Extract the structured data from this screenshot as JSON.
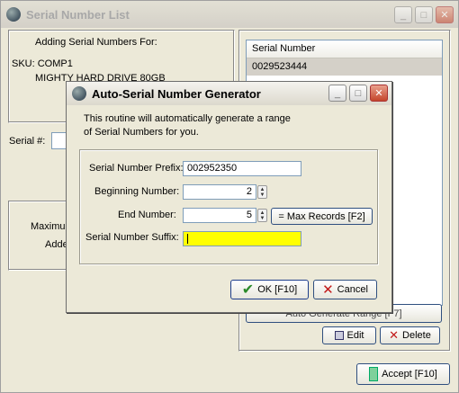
{
  "main_window": {
    "title": "Serial Number List",
    "adding_label": "Adding Serial Numbers For:",
    "sku_line": "SKU: COMP1",
    "product_line": "MIGHTY HARD DRIVE 80GB",
    "serial_label": "Serial #:",
    "max_label_partial": "Maximum",
    "added_label_partial": "Adde",
    "list_header": "Serial Number",
    "list_items": [
      "0029523444"
    ],
    "auto_generate_label_partial": "Auto Generate Range [F7]",
    "edit_label": "Edit",
    "delete_label": "Delete",
    "accept_label": "Accept [F10]"
  },
  "dialog": {
    "title": "Auto-Serial Number Generator",
    "intro_line1": "This routine will automatically generate a range",
    "intro_line2": "of Serial Numbers for you.",
    "prefix_label": "Serial Number Prefix:",
    "prefix_value": "002952350",
    "begin_label": "Beginning Number:",
    "begin_value": "2",
    "end_label": "End Number:",
    "end_value": "5",
    "max_records_label": "= Max Records [F2]",
    "suffix_label": "Serial Number Suffix:",
    "suffix_value": "",
    "ok_label": "OK [F10]",
    "cancel_label": "Cancel"
  },
  "colors": {
    "highlight_field": "#ffff00",
    "selected_row": "#d4d0c8",
    "ok_check": "#2a8a2a",
    "cancel_x": "#c21a1a"
  }
}
